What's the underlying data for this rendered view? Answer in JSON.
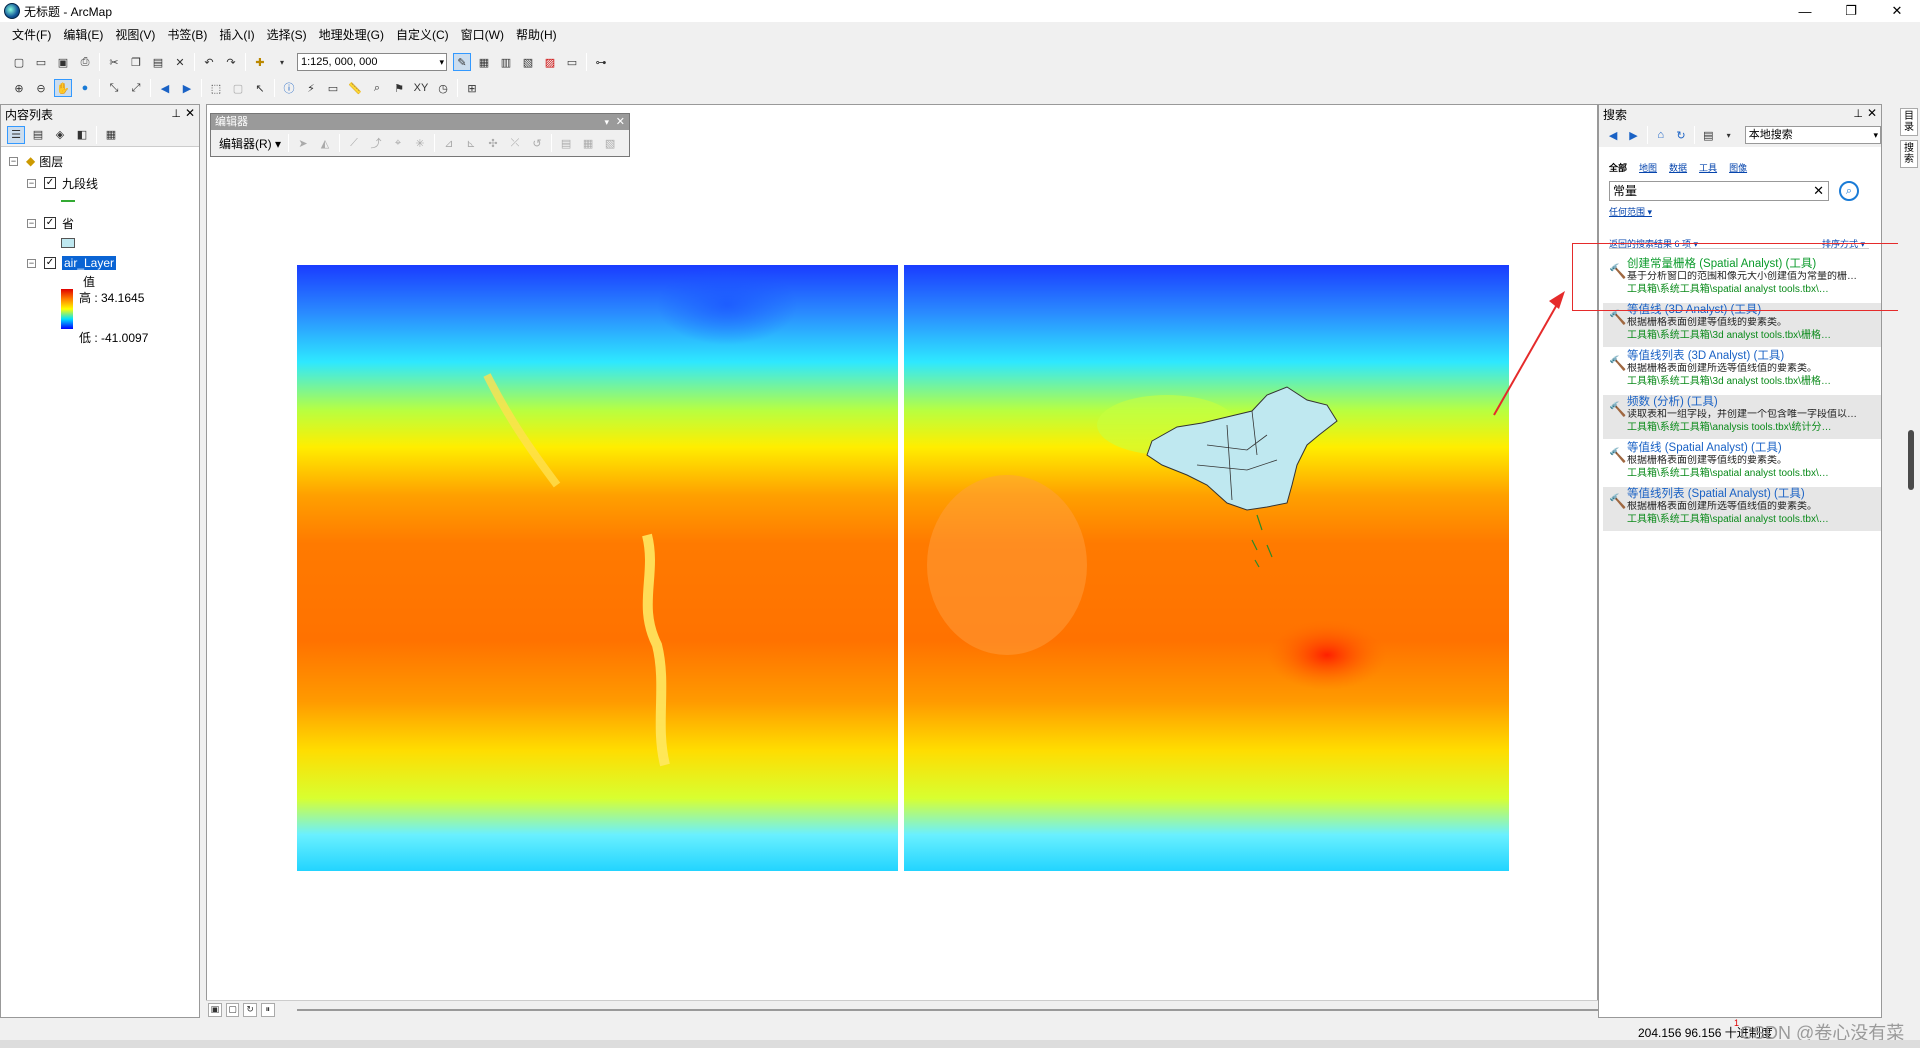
{
  "window": {
    "title": "无标题 - ArcMap",
    "min": "—",
    "max": "❐",
    "close": "✕"
  },
  "menu": [
    "文件(F)",
    "编辑(E)",
    "视图(V)",
    "书签(B)",
    "插入(I)",
    "选择(S)",
    "地理处理(G)",
    "自定义(C)",
    "窗口(W)",
    "帮助(H)"
  ],
  "toolbar": {
    "scale": "1:125, 000, 000"
  },
  "toc": {
    "title": "内容列表",
    "root": "图层",
    "layers": [
      {
        "name": "九段线"
      },
      {
        "name": "省"
      },
      {
        "name": "air_Layer",
        "legend_title": "值",
        "high": "高 : 34.1645",
        "low": "低 : -41.0097"
      }
    ]
  },
  "editor": {
    "title": "编辑器",
    "menu": "编辑器(R) ▾"
  },
  "search": {
    "title": "搜索",
    "scope": "本地搜索",
    "tabs": [
      "全部",
      "地图",
      "数据",
      "工具",
      "图像"
    ],
    "query": "常量",
    "extent": "任何范围 ▾",
    "result_info": "返回的搜索结果 6 项 ▾",
    "sort": "排序方式 ▾",
    "results": [
      {
        "title": "创建常量栅格 (Spatial Analyst) (工具)",
        "desc": "基于分析窗口的范围和像元大小创建值为常量的栅…",
        "path": "工具箱\\系统工具箱\\spatial analyst tools.tbx\\…"
      },
      {
        "title": "等值线 (3D Analyst) (工具)",
        "desc": "根据栅格表面创建等值线的要素类。",
        "path": "工具箱\\系统工具箱\\3d analyst tools.tbx\\栅格…"
      },
      {
        "title": "等值线列表 (3D Analyst) (工具)",
        "desc": "根据栅格表面创建所选等值线值的要素类。",
        "path": "工具箱\\系统工具箱\\3d analyst tools.tbx\\栅格…"
      },
      {
        "title": "频数 (分析) (工具)",
        "desc": "读取表和一组字段，并创建一个包含唯一字段值以…",
        "path": "工具箱\\系统工具箱\\analysis tools.tbx\\统计分…"
      },
      {
        "title": "等值线 (Spatial Analyst) (工具)",
        "desc": "根据栅格表面创建等值线的要素类。",
        "path": "工具箱\\系统工具箱\\spatial analyst tools.tbx\\…"
      },
      {
        "title": "等值线列表 (Spatial Analyst) (工具)",
        "desc": "根据栅格表面创建所选等值线值的要素类。",
        "path": "工具箱\\系统工具箱\\spatial analyst tools.tbx\\…"
      }
    ]
  },
  "rightbar": [
    "目录",
    "搜索"
  ],
  "status": {
    "coords": "204.156  96.156 十进制度",
    "counter": "1",
    "watermark": "CSDN @卷心没有菜"
  },
  "icons": [
    "app-icon",
    "new-icon",
    "open-icon",
    "save-icon",
    "print-icon",
    "cut-icon",
    "copy-icon",
    "paste-icon",
    "delete-icon",
    "undo-icon",
    "redo-icon",
    "add-data-icon",
    "zoom-in-icon",
    "zoom-out-icon",
    "pan-icon",
    "full-extent-icon",
    "back-icon",
    "forward-icon",
    "select-icon",
    "identify-icon",
    "find-icon",
    "search-go-icon",
    "tool-icon"
  ]
}
